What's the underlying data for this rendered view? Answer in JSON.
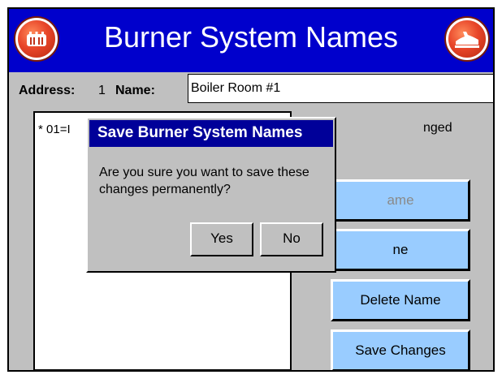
{
  "header": {
    "title": "Burner System Names",
    "left_icon": "burner-system-icon",
    "right_icon": "exit-icon"
  },
  "address": {
    "label": "Address:",
    "value": "1"
  },
  "name": {
    "label": "Name:",
    "value": "Boiler Room #1"
  },
  "list": {
    "items": [
      "* 01=I"
    ]
  },
  "status": {
    "text": "nged"
  },
  "buttons": {
    "add_name": "ame",
    "rename": "ne",
    "delete": "Delete Name",
    "save": "Save Changes"
  },
  "dialog": {
    "title": "Save Burner System Names",
    "message": "Are you sure you want to save these changes permanently?",
    "yes": "Yes",
    "no": "No"
  },
  "colors": {
    "title_bar": "#0000cc",
    "dialog_title_bar": "#000099",
    "button_face": "#99ccff",
    "window_bg": "#c0c0c0",
    "icon_red": "#e8462a"
  }
}
